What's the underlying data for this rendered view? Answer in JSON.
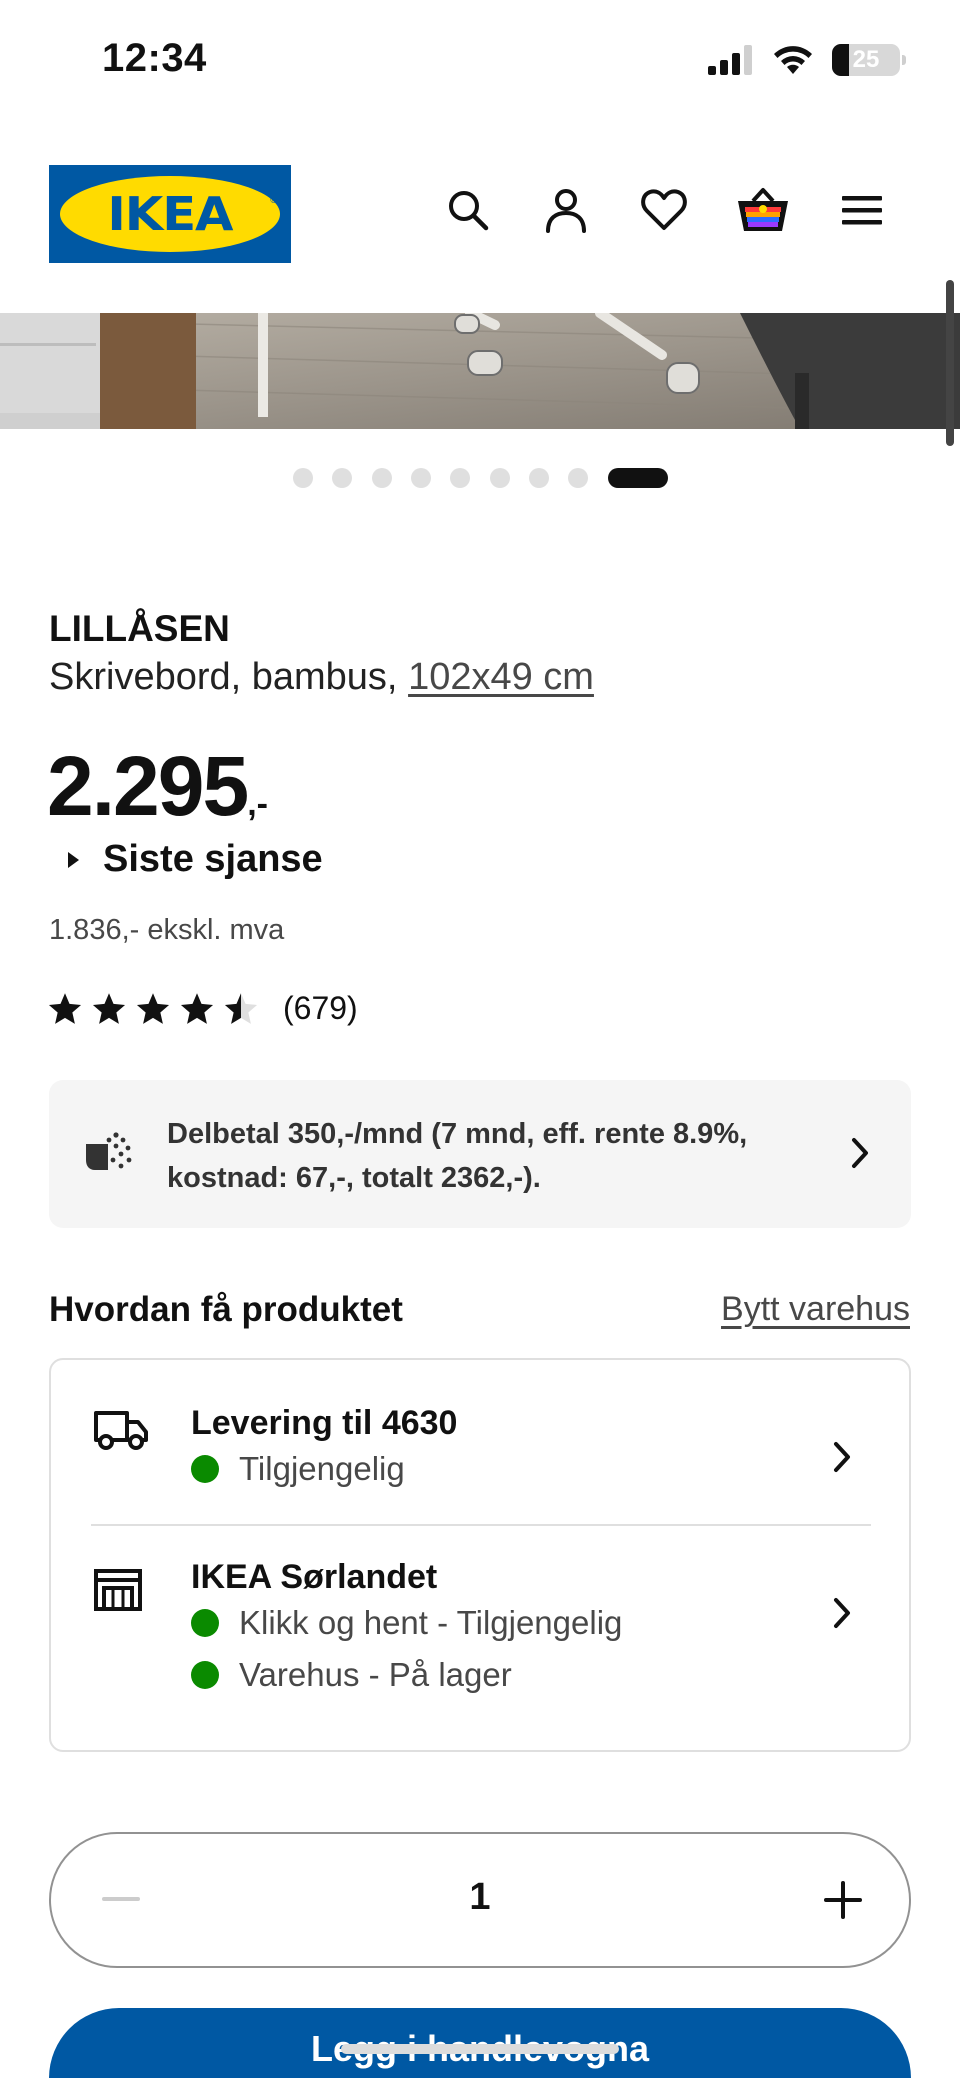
{
  "status_bar": {
    "time": "12:34",
    "battery": "25"
  },
  "header": {
    "logo_text": "IKEA",
    "icons": [
      "search-icon",
      "user-icon",
      "heart-icon",
      "basket-icon",
      "menu-icon"
    ]
  },
  "gallery": {
    "dot_count": 9,
    "active_index": 8
  },
  "product": {
    "name": "LILLÅSEN",
    "description": "Skrivebord, bambus,",
    "size": "102x49 cm",
    "price": "2.295",
    "price_suffix": ",-",
    "badge": "Siste sjanse",
    "ex_vat": "1.836,- ekskl. mva",
    "rating": 4.5,
    "rating_count": "(679)"
  },
  "finance": {
    "text": "Delbetal 350,-/mnd (7 mnd, eff. rente 8.9%, kostnad: 67,-, totalt 2362,-)."
  },
  "availability": {
    "title": "Hvordan få produktet",
    "change_store": "Bytt varehus",
    "delivery": {
      "title": "Levering til 4630",
      "status": "Tilgjengelig"
    },
    "store": {
      "title": "IKEA Sørlandet",
      "click_collect": "Klikk og hent - Tilgjengelig",
      "in_store": "Varehus - På lager"
    },
    "status_color": "#0a8a00"
  },
  "quantity": {
    "value": "1"
  },
  "cart": {
    "label": "Legg i handlevogna"
  },
  "colors": {
    "brand_blue": "#0058a3",
    "brand_yellow": "#ffdb00"
  }
}
